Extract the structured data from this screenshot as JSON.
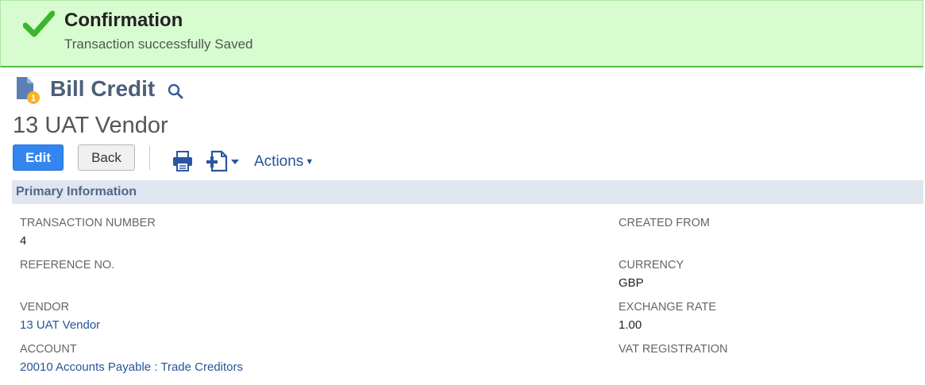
{
  "confirmation": {
    "title": "Confirmation",
    "message": "Transaction successfully Saved",
    "icon": "checkmark-icon",
    "color": "#4bbf3a"
  },
  "record": {
    "type": "Bill Credit",
    "name": "13 UAT Vendor",
    "type_icon": "bill-credit-icon"
  },
  "toolbar": {
    "edit_label": "Edit",
    "back_label": "Back",
    "actions_label": "Actions",
    "print_icon": "print-icon",
    "new_document_icon": "new-document-icon"
  },
  "section": {
    "title": "Primary Information"
  },
  "fields_left": [
    {
      "label": "TRANSACTION NUMBER",
      "value": "4"
    },
    {
      "label": "REFERENCE NO.",
      "value": ""
    },
    {
      "label": "VENDOR",
      "value": "13 UAT Vendor"
    },
    {
      "label": "ACCOUNT",
      "value": "20010 Accounts Payable : Trade Creditors"
    }
  ],
  "fields_right": [
    {
      "label": "CREATED FROM",
      "value": ""
    },
    {
      "label": "CURRENCY",
      "value": "GBP"
    },
    {
      "label": "EXCHANGE RATE",
      "value": "1.00"
    },
    {
      "label": "VAT REGISTRATION",
      "value": ""
    }
  ],
  "colors": {
    "accent": "#3386f0",
    "link": "#255599",
    "section_bar": "#e0e6ef",
    "confirm_bg": "#d7fccf"
  }
}
